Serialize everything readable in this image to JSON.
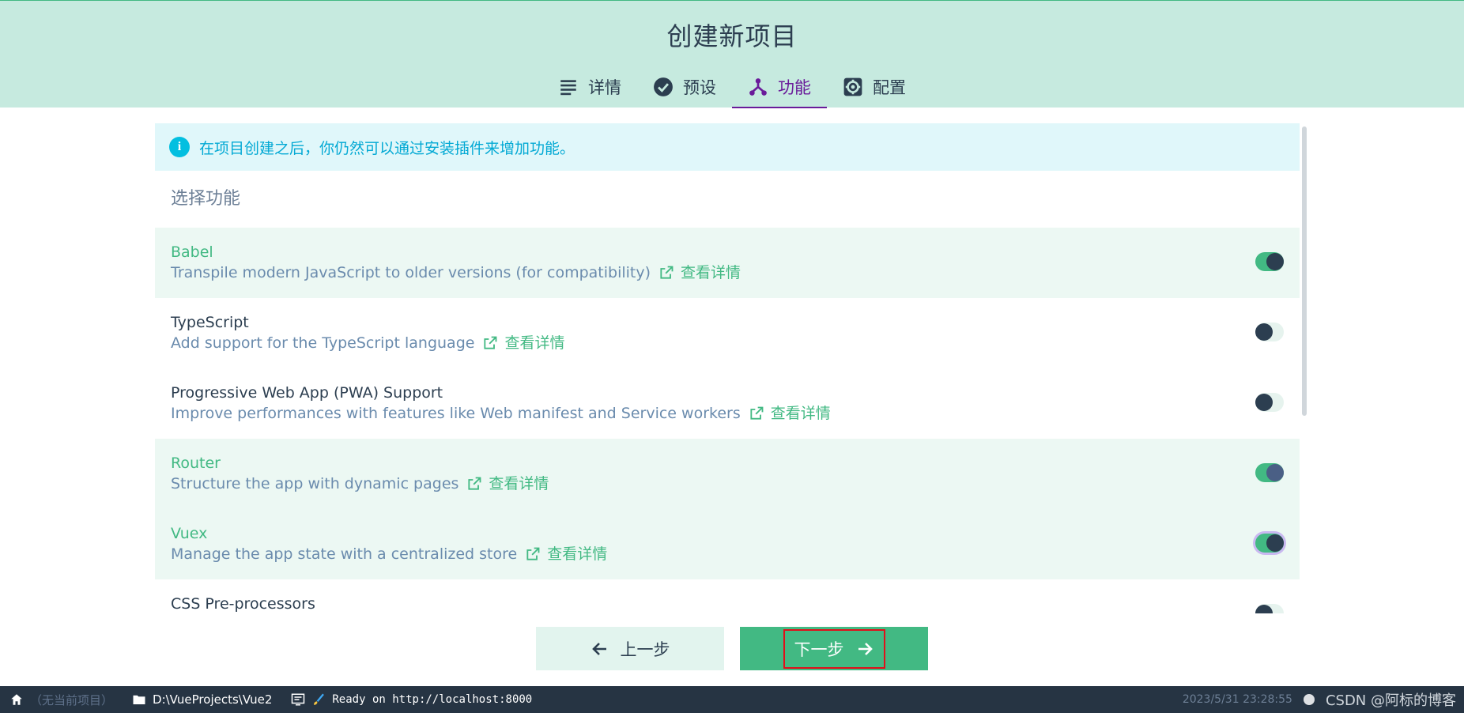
{
  "header": {
    "title": "创建新项目",
    "tabs": [
      {
        "label": "详情",
        "icon": "list-icon",
        "active": false
      },
      {
        "label": "预设",
        "icon": "check-circle-icon",
        "active": false
      },
      {
        "label": "功能",
        "icon": "branch-icon",
        "active": true
      },
      {
        "label": "配置",
        "icon": "gear-icon",
        "active": false
      }
    ]
  },
  "main": {
    "info_text": "在项目创建之后，你仍然可以通过安装插件来增加功能。",
    "section_title": "选择功能",
    "link_label": "查看详情",
    "features": [
      {
        "name": "Babel",
        "desc": "Transpile modern JavaScript to older versions (for compatibility)",
        "enabled": true
      },
      {
        "name": "TypeScript",
        "desc": "Add support for the TypeScript language",
        "enabled": false
      },
      {
        "name": "Progressive Web App (PWA) Support",
        "desc": "Improve performances with features like Web manifest and Service workers",
        "enabled": false
      },
      {
        "name": "Router",
        "desc": "Structure the app with dynamic pages",
        "enabled": true
      },
      {
        "name": "Vuex",
        "desc": "Manage the app state with a centralized store",
        "enabled": true
      },
      {
        "name": "CSS Pre-processors",
        "desc": "",
        "enabled": false
      }
    ]
  },
  "buttons": {
    "prev_label": "上一步",
    "next_label": "下一步"
  },
  "statusbar": {
    "no_project": "（无当前项目）",
    "path": "D:\\VueProjects\\Vue2",
    "log": "Ready on http://localhost:8000",
    "datetime": "2023/5/31 23:28:55",
    "watermark": "CSDN @阿标的博客"
  },
  "colors": {
    "accent": "#42b983",
    "header_bg": "#c6eadf",
    "active_tab": "#6a1b9a",
    "info": "#03a9d4",
    "statusbar_bg": "#263443"
  }
}
